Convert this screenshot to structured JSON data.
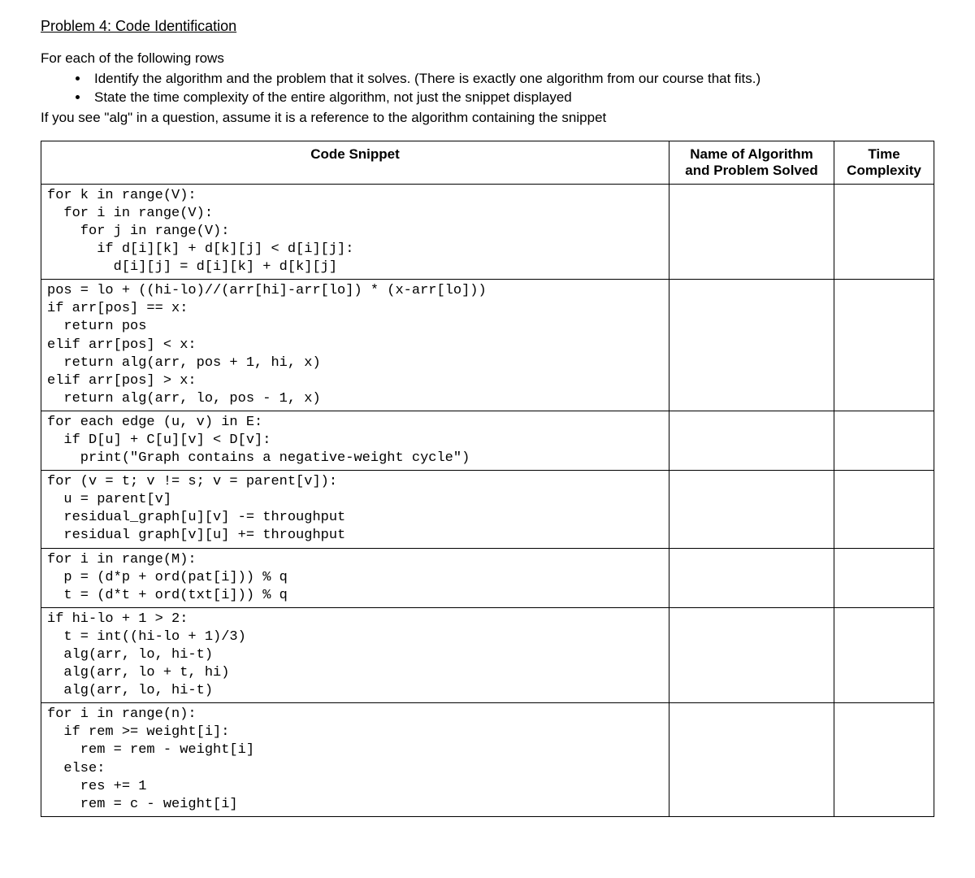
{
  "title": "Problem 4: Code Identification",
  "intro": "For each of the following rows",
  "bullets": [
    "Identify the algorithm and the problem that it solves. (There is exactly one algorithm from our course that fits.)",
    "State the time complexity of the entire algorithm, not just the snippet displayed"
  ],
  "post_bullets": "If you see \"alg\" in a question, assume it is a reference to the algorithm containing the snippet",
  "headers": {
    "snippet": "Code Snippet",
    "name_line1": "Name of Algorithm",
    "name_line2": "and Problem Solved",
    "complexity_line1": "Time",
    "complexity_line2": "Complexity"
  },
  "rows": [
    {
      "code": "for k in range(V):\n  for i in range(V):\n    for j in range(V):\n      if d[i][k] + d[k][j] < d[i][j]:\n        d[i][j] = d[i][k] + d[k][j]",
      "name": "",
      "complexity": ""
    },
    {
      "code": "pos = lo + ((hi-lo)//(arr[hi]-arr[lo]) * (x-arr[lo]))\nif arr[pos] == x:\n  return pos\nelif arr[pos] < x:\n  return alg(arr, pos + 1, hi, x)\nelif arr[pos] > x:\n  return alg(arr, lo, pos - 1, x)",
      "name": "",
      "complexity": ""
    },
    {
      "code": "for each edge (u, v) in E:\n  if D[u] + C[u][v] < D[v]:\n    print(\"Graph contains a negative-weight cycle\")",
      "name": "",
      "complexity": ""
    },
    {
      "code": "for (v = t; v != s; v = parent[v]):\n  u = parent[v]\n  residual_graph[u][v] -= throughput\n  residual graph[v][u] += throughput",
      "name": "",
      "complexity": ""
    },
    {
      "code": "for i in range(M):\n  p = (d*p + ord(pat[i])) % q\n  t = (d*t + ord(txt[i])) % q",
      "name": "",
      "complexity": ""
    },
    {
      "code": "if hi-lo + 1 > 2:\n  t = int((hi-lo + 1)/3)\n  alg(arr, lo, hi-t)\n  alg(arr, lo + t, hi)\n  alg(arr, lo, hi-t)",
      "name": "",
      "complexity": ""
    },
    {
      "code": "for i in range(n):\n  if rem >= weight[i]:\n    rem = rem - weight[i]\n  else:\n    res += 1\n    rem = c - weight[i]",
      "name": "",
      "complexity": ""
    }
  ]
}
